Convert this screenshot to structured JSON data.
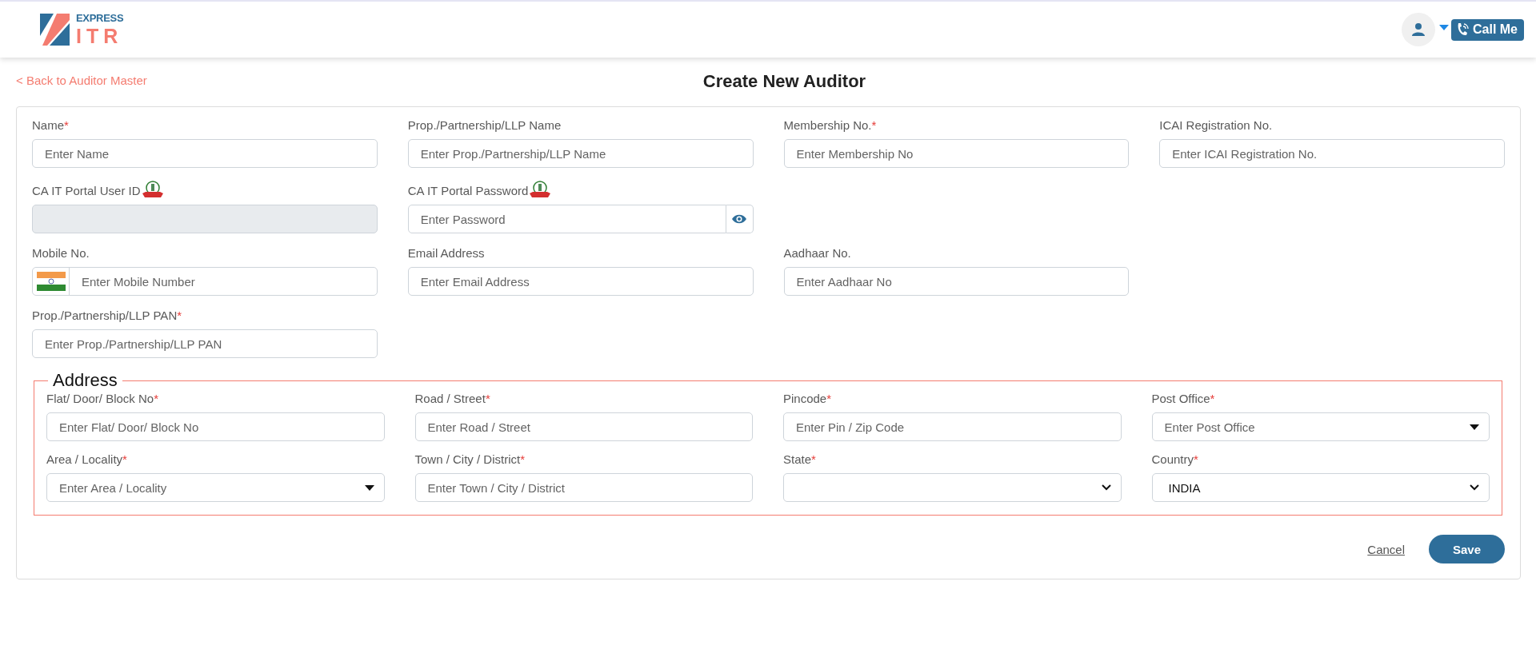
{
  "header": {
    "logo_top": "EXPRESS",
    "logo_bottom": "ITR",
    "call_button": "Call Me"
  },
  "back_link": "< Back to Auditor Master",
  "title": "Create New Auditor",
  "form": {
    "rows": [
      [
        {
          "label": "Name",
          "required_mark": "*",
          "kind": "text",
          "placeholder": "Enter Name",
          "disabled": false
        },
        {
          "label": "Prop./Partnership/LLP Name",
          "kind": "text",
          "placeholder": "Enter Prop./Partnership/LLP Name",
          "disabled": false
        },
        {
          "label": "Membership No.",
          "required_mark": "*",
          "kind": "text",
          "placeholder": "Enter Membership No",
          "disabled": false
        },
        {
          "label": "ICAI Registration No.",
          "kind": "text",
          "placeholder": "Enter ICAI Registration No.",
          "disabled": false
        }
      ],
      [
        {
          "label": "CA IT Portal User ID",
          "emblem": true,
          "kind": "text",
          "disabled": true
        },
        {
          "label": "CA IT Portal Password",
          "emblem": true,
          "kind": "password",
          "placeholder": "Enter Password",
          "disabled": false
        }
      ],
      [
        {
          "label": "Mobile No.",
          "kind": "phone",
          "placeholder": "Enter Mobile Number",
          "disabled": false
        },
        {
          "label": "Email Address",
          "kind": "text",
          "placeholder": "Enter Email Address",
          "disabled": false
        },
        {
          "label": "Aadhaar No.",
          "kind": "text",
          "placeholder": "Enter Aadhaar No",
          "disabled": false
        }
      ],
      [
        {
          "label": "Prop./Partnership/LLP PAN",
          "required_mark": "*",
          "kind": "text",
          "placeholder": "Enter Prop./Partnership/LLP PAN",
          "disabled": false
        }
      ]
    ]
  },
  "address": {
    "legend": "Address",
    "rows": [
      [
        {
          "label": "Flat/ Door/ Block No",
          "required_mark": "*",
          "kind": "text",
          "placeholder": "Enter Flat/ Door/ Block No",
          "disabled": false
        },
        {
          "label": "Road / Street",
          "required_mark": "*",
          "kind": "text",
          "placeholder": "Enter Road / Street",
          "disabled": false
        },
        {
          "label": "Pincode",
          "required_mark": "*",
          "kind": "text",
          "placeholder": "Enter Pin / Zip Code",
          "disabled": false
        },
        {
          "label": "Post Office",
          "required_mark": "*",
          "kind": "combo",
          "placeholder": "Enter Post Office",
          "disabled": false
        }
      ],
      [
        {
          "label": "Area / Locality",
          "required_mark": "*",
          "kind": "combo",
          "placeholder": "Enter Area / Locality",
          "disabled": false
        },
        {
          "label": "Town / City / District",
          "required_mark": "*",
          "kind": "text",
          "placeholder": "Enter Town / City / District",
          "disabled": false
        },
        {
          "label": "State",
          "required_mark": "*",
          "kind": "select",
          "disabled": false
        },
        {
          "label": "Country",
          "required_mark": "*",
          "kind": "select",
          "value": "INDIA",
          "disabled": false
        }
      ]
    ]
  },
  "actions": {
    "cancel": "Cancel",
    "save": "Save"
  }
}
